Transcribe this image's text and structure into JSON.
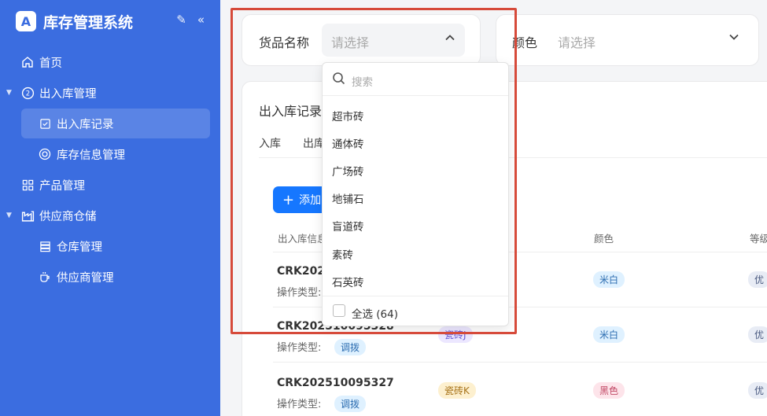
{
  "sidebar": {
    "brand_title": "库存管理系统",
    "items": [
      {
        "label": "首页"
      },
      {
        "label": "出入库管理"
      },
      {
        "label": "出入库记录"
      },
      {
        "label": "库存信息管理"
      },
      {
        "label": "产品管理"
      },
      {
        "label": "供应商仓储"
      },
      {
        "label": "仓库管理"
      },
      {
        "label": "供应商管理"
      }
    ]
  },
  "filters": {
    "product_label": "货品名称",
    "product_placeholder": "请选择",
    "color_label": "颜色",
    "color_placeholder": "请选择"
  },
  "dropdown": {
    "search_placeholder": "搜索",
    "options": [
      "超市砖",
      "通体砖",
      "广场砖",
      "地铺石",
      "盲道砖",
      "素砖",
      "石英砖"
    ],
    "select_all": "全选 (64)"
  },
  "records": {
    "title": "出入库记录",
    "tabs": [
      "入库",
      "出库"
    ],
    "add_label": "添加",
    "columns": {
      "info": "出入库信息",
      "color": "颜色",
      "grade": "等级"
    },
    "rows": [
      {
        "code": "CRK202",
        "type_label": "操作类型:",
        "type": "",
        "product": "",
        "color": "米白",
        "grade": "优"
      },
      {
        "code": "CRK202510095328",
        "type_label": "操作类型:",
        "type": "调拨",
        "product": "瓷砖J",
        "color": "米白",
        "grade": "优"
      },
      {
        "code": "CRK202510095327",
        "type_label": "操作类型:",
        "type": "调拨",
        "product": "瓷砖K",
        "color": "黑色",
        "grade": "优"
      }
    ]
  },
  "colors": {
    "sidebar": "#3b6de0",
    "highlight": "#d64a3a",
    "primary": "#1677ff"
  }
}
